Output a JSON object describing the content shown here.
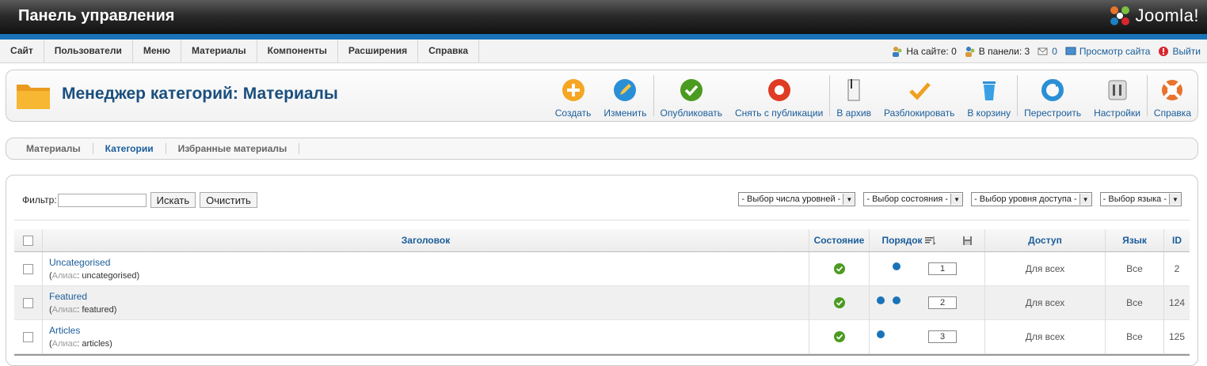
{
  "header": {
    "title": "Панель управления",
    "logo_text": "Joomla!"
  },
  "menu": {
    "items": [
      "Сайт",
      "Пользователи",
      "Меню",
      "Материалы",
      "Компоненты",
      "Расширения",
      "Справка"
    ]
  },
  "status": {
    "on_site": "На сайте: 0",
    "in_panel": "В панели: 3",
    "messages": "0",
    "preview": "Просмотр сайта",
    "logout": "Выйти"
  },
  "page": {
    "title": "Менеджер категорий: Материалы"
  },
  "toolbar": {
    "create": "Создать",
    "edit": "Изменить",
    "publish": "Опубликовать",
    "unpublish": "Снять с публикации",
    "archive": "В архив",
    "checkin": "Разблокировать",
    "trash": "В корзину",
    "rebuild": "Перестроить",
    "options": "Настройки",
    "help": "Справка"
  },
  "submenu": {
    "items": [
      "Материалы",
      "Категории",
      "Избранные материалы"
    ],
    "active": "Категории"
  },
  "filter": {
    "label": "Фильтр:",
    "value": "",
    "search_button": "Искать",
    "clear_button": "Очистить",
    "selects": [
      "- Выбор числа уровней -",
      "- Выбор состояния -",
      "- Выбор уровня доступа -",
      "- Выбор языка -"
    ]
  },
  "table": {
    "headers": {
      "title": "Заголовок",
      "state": "Состояние",
      "order": "Порядок",
      "access": "Доступ",
      "language": "Язык",
      "id": "ID"
    },
    "alias_label": "Алиас",
    "rows": [
      {
        "title": "Uncategorised",
        "alias": "uncategorised",
        "order": "1",
        "access": "Для всех",
        "language": "Все",
        "id": "2"
      },
      {
        "title": "Featured",
        "alias": "featured",
        "order": "2",
        "access": "Для всех",
        "language": "Все",
        "id": "124"
      },
      {
        "title": "Articles",
        "alias": "articles",
        "order": "3",
        "access": "Для всех",
        "language": "Все",
        "id": "125"
      }
    ]
  },
  "colors": {
    "accent": "#1a73b8",
    "link": "#1a5d9b",
    "title": "#1a4f7e"
  }
}
